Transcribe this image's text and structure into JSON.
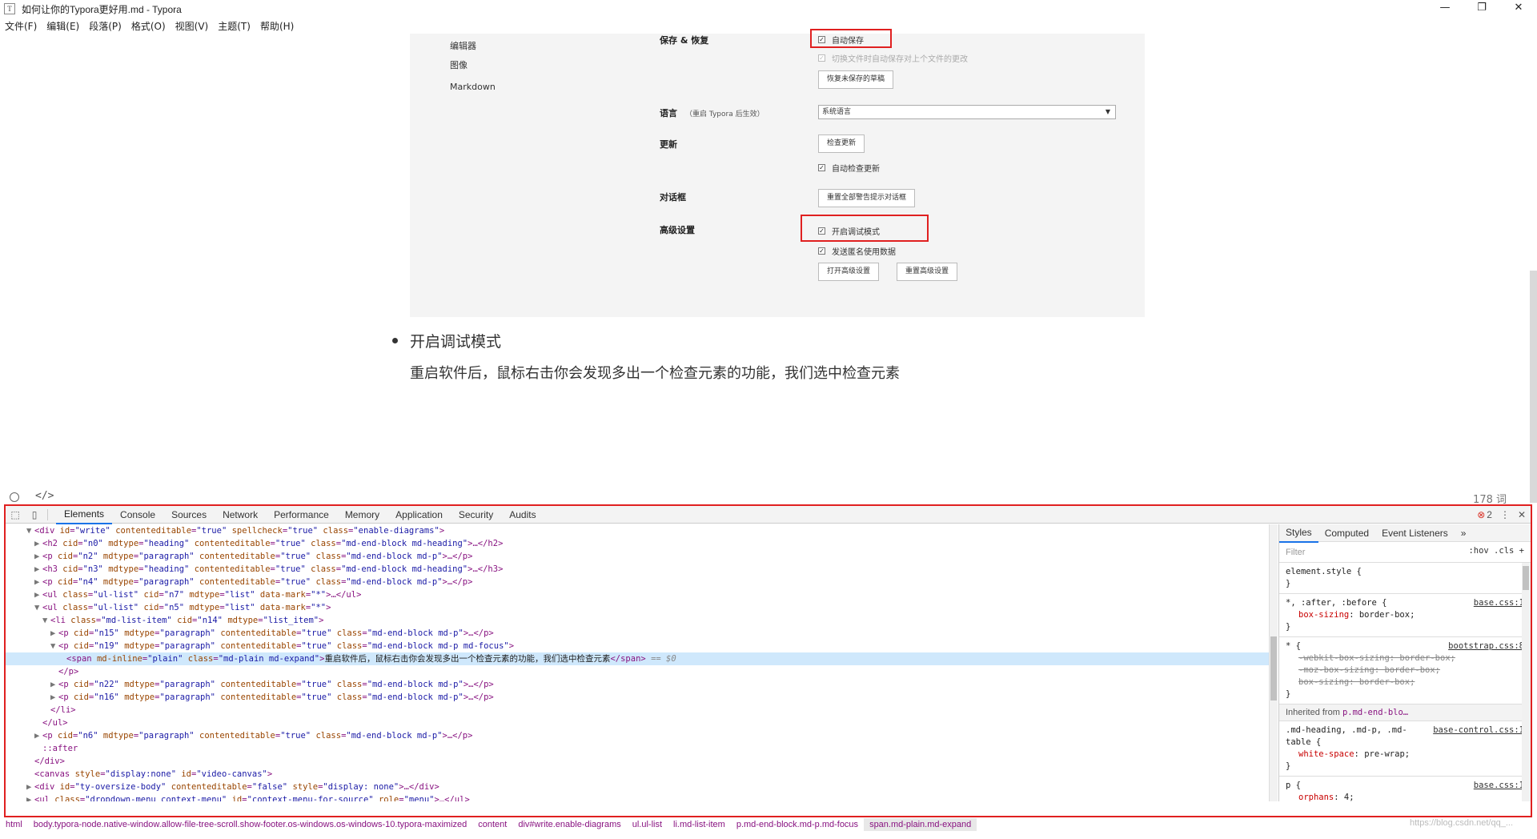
{
  "window": {
    "title": "如何让你的Typora更好用.md - Typora",
    "icon_glyph": "T",
    "minimize": "—",
    "restore": "❐",
    "close": "✕"
  },
  "menu": [
    "文件(F)",
    "编辑(E)",
    "段落(P)",
    "格式(O)",
    "视图(V)",
    "主题(T)",
    "帮助(H)"
  ],
  "prefs": {
    "nav": [
      "编辑器",
      "图像",
      "Markdown"
    ],
    "save_restore": "保存 & 恢复",
    "auto_save": "自动保存",
    "switch_save": "切换文件时自动保存对上个文件的更改",
    "recover_btn": "恢复未保存的草稿",
    "language": "语言",
    "language_hint": "（重启 Typora 后生效）",
    "language_value": "系统语言",
    "update": "更新",
    "check_update_btn": "检查更新",
    "auto_check_update": "自动检查更新",
    "dialog": "对话框",
    "reset_dialogs_btn": "重置全部警告提示对话框",
    "advanced": "高级设置",
    "debug_mode": "开启调试模式",
    "send_anonymous": "发送匿名使用数据",
    "open_advanced_btn": "打开高级设置",
    "reset_advanced_btn": "重置高级设置"
  },
  "doc": {
    "bullet": "开启调试模式",
    "paragraph": "重启软件后，鼠标右击你会发现多出一个检查元素的功能，我们选中检查元素"
  },
  "footer": {
    "code_glyph": "</>",
    "word_count": "178 词"
  },
  "devtools": {
    "tabs": [
      "Elements",
      "Console",
      "Sources",
      "Network",
      "Performance",
      "Memory",
      "Application",
      "Security",
      "Audits"
    ],
    "error_count": "2",
    "styles_tabs": [
      "Styles",
      "Computed",
      "Event Listeners"
    ],
    "styles_more": "»",
    "filter_placeholder": "Filter",
    "filter_tools": ":hov  .cls  +",
    "inherited_label": "Inherited from",
    "inherited_selector": "p.md-end-blo…",
    "dom_selected_text": "重启软件后，鼠标右击你会发现多出一个检查元素的功能，我们选中检查元素",
    "breadcrumbs": [
      "html",
      "body.typora-node.native-window.allow-file-tree-scroll.show-footer.os-windows.os-windows-10.typora-maximized",
      "content",
      "div#write.enable-diagrams",
      "ul.ul-list",
      "li.md-list-item",
      "p.md-end-block.md-p.md-focus",
      "span.md-plain.md-expand"
    ]
  },
  "watermark": "https://blog.csdn.net/qq_..."
}
